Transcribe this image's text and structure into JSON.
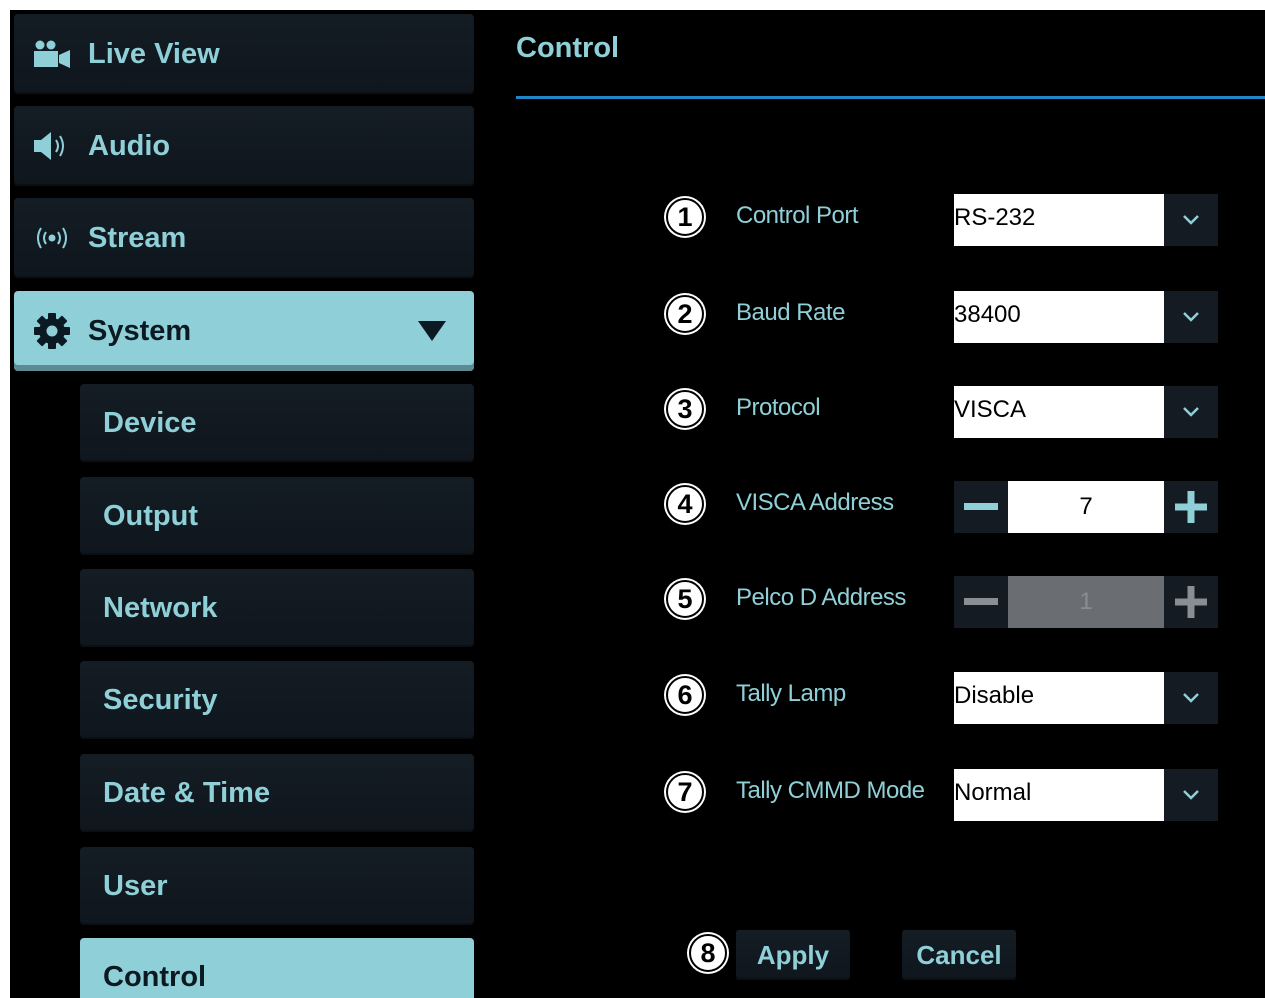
{
  "sidebar": {
    "items": [
      {
        "label": "Live View",
        "icon": "camera-icon"
      },
      {
        "label": "Audio",
        "icon": "speaker-icon"
      },
      {
        "label": "Stream",
        "icon": "broadcast-icon"
      },
      {
        "label": "System",
        "icon": "gear-icon"
      }
    ],
    "sub_items": [
      {
        "label": "Device"
      },
      {
        "label": "Output"
      },
      {
        "label": "Network"
      },
      {
        "label": "Security"
      },
      {
        "label": "Date & Time"
      },
      {
        "label": "User"
      },
      {
        "label": "Control"
      }
    ],
    "active_item": "System",
    "active_sub_item": "Control"
  },
  "main": {
    "title": "Control",
    "fields": [
      {
        "num": "1",
        "label": "Control Port",
        "value": "RS-232"
      },
      {
        "num": "2",
        "label": "Baud Rate",
        "value": "38400"
      },
      {
        "num": "3",
        "label": "Protocol",
        "value": "VISCA"
      },
      {
        "num": "4",
        "label": "VISCA Address",
        "value": "7"
      },
      {
        "num": "5",
        "label": "Pelco D Address",
        "value": "1"
      },
      {
        "num": "6",
        "label": "Tally Lamp",
        "value": "Disable"
      },
      {
        "num": "7",
        "label": "Tally CMMD Mode",
        "value": "Normal"
      }
    ],
    "actions": {
      "num": "8",
      "apply_label": "Apply",
      "cancel_label": "Cancel"
    }
  },
  "colors": {
    "accent_text": "#8fd0d8",
    "active_bg": "#8fcfd8",
    "rule": "#1e86c4",
    "background": "#000000"
  }
}
